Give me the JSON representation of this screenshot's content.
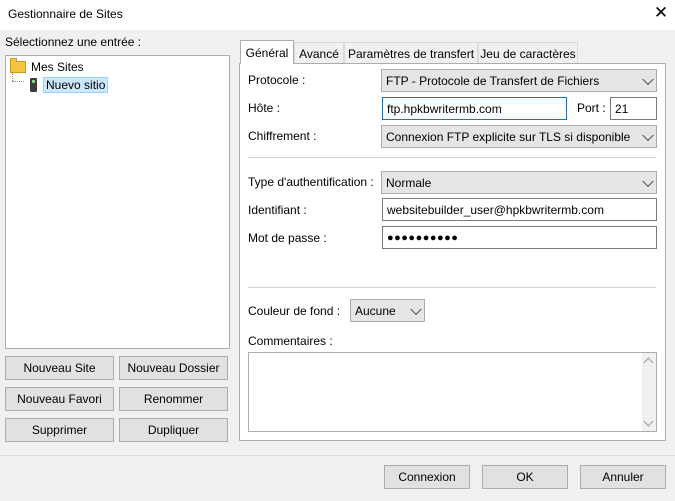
{
  "window": {
    "title": "Gestionnaire de Sites",
    "close_glyph": "✕"
  },
  "left": {
    "select_label": "Sélectionnez une entrée :",
    "tree": [
      {
        "label": "Mes Sites",
        "icon": "folder-icon"
      },
      {
        "label": "Nuevo sitio",
        "icon": "server-icon",
        "selected": true
      }
    ],
    "buttons": {
      "new_site": "Nouveau Site",
      "new_folder": "Nouveau Dossier",
      "new_bookmark": "Nouveau Favori",
      "rename": "Renommer",
      "delete": "Supprimer",
      "duplicate": "Dupliquer"
    }
  },
  "tabs": [
    "Général",
    "Avancé",
    "Paramètres de transfert",
    "Jeu de caractères"
  ],
  "general": {
    "protocol_label": "Protocole :",
    "protocol_value": "FTP - Protocole de Transfert de Fichiers",
    "host_label": "Hôte :",
    "host_value": "ftp.hpkbwritermb.com",
    "port_label": "Port :",
    "port_value": "21",
    "encryption_label": "Chiffrement :",
    "encryption_value": "Connexion FTP explicite sur TLS si disponible",
    "auth_type_label": "Type d'authentification :",
    "auth_type_value": "Normale",
    "user_label": "Identifiant :",
    "user_value": "websitebuilder_user@hpkbwritermb.com",
    "password_label": "Mot de passe :",
    "password_value": "●●●●●●●●●●",
    "bgcolor_label": "Couleur de fond :",
    "bgcolor_value": "Aucune",
    "comments_label": "Commentaires :"
  },
  "footer": {
    "connect": "Connexion",
    "ok": "OK",
    "cancel": "Annuler"
  },
  "colors": {
    "focus_border": "#0078d7",
    "selection_bg": "#cce8ff"
  }
}
